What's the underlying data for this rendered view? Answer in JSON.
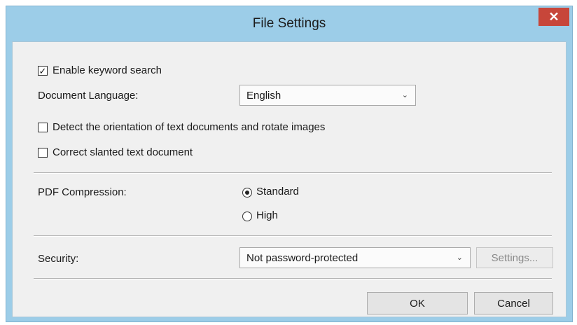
{
  "window": {
    "title": "File Settings",
    "close_glyph": "✕"
  },
  "keyword_search": {
    "label": "Enable keyword search",
    "checked": true,
    "check_glyph": "✓"
  },
  "document_language": {
    "label": "Document Language:",
    "value": "English",
    "chevron": "⌄"
  },
  "detect_orientation": {
    "label": "Detect the orientation of text documents and rotate images",
    "checked": false
  },
  "correct_slanted": {
    "label": "Correct slanted text document",
    "checked": false
  },
  "pdf_compression": {
    "label": "PDF Compression:",
    "options": [
      {
        "label": "Standard",
        "selected": true
      },
      {
        "label": "High",
        "selected": false
      }
    ]
  },
  "security": {
    "label": "Security:",
    "value": "Not password-protected",
    "chevron": "⌄",
    "settings_label": "Settings..."
  },
  "footer": {
    "ok_label": "OK",
    "cancel_label": "Cancel"
  },
  "colors": {
    "title_bar": "#9ccde8",
    "close_button": "#c7463a",
    "client_bg": "#f0f0f0"
  },
  "icons": {
    "close": "close-icon",
    "checkbox_check": "check-icon",
    "dropdown": "chevron-down-icon"
  }
}
